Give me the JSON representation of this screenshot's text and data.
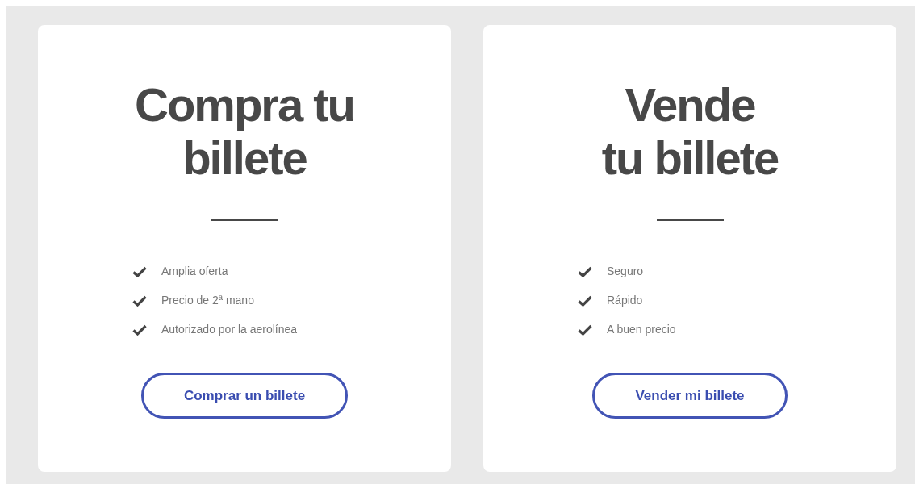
{
  "cards": [
    {
      "title_lines": [
        "Compra tu",
        "billete"
      ],
      "features": [
        "Amplia oferta",
        "Precio de 2ª mano",
        "Autorizado por la aerolínea"
      ],
      "button": "Comprar un billete"
    },
    {
      "title_lines": [
        "Vende",
        "tu billete"
      ],
      "features": [
        "Seguro",
        "Rápido",
        "A buen precio"
      ],
      "button": "Vender mi billete"
    }
  ]
}
